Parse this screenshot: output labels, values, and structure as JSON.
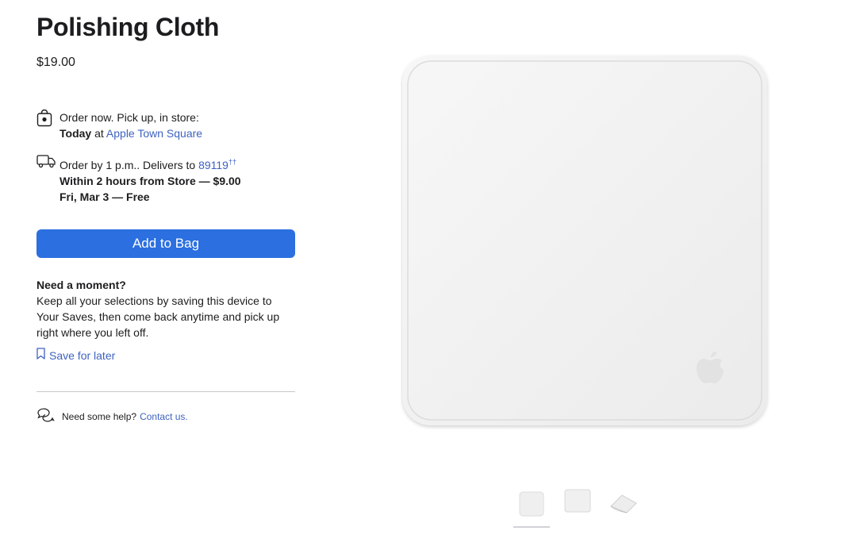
{
  "product": {
    "title": "Polishing Cloth",
    "price": "$19.00",
    "image_alt": "White polishing cloth with Apple logo"
  },
  "pickup": {
    "icon": "store-bag-icon",
    "line1": "Order now. Pick up, in store:",
    "day": "Today",
    "at": "at",
    "store": "Apple Town Square"
  },
  "delivery": {
    "icon": "delivery-truck-icon",
    "line1_prefix": "Order by 1 p.m.. Delivers to",
    "zip": "89119",
    "zip_suffix": "††",
    "option1": "Within 2 hours from Store — $9.00",
    "option2": "Fri, Mar 3 — Free"
  },
  "add_to_bag_label": "Add to Bag",
  "save": {
    "heading": "Need a moment?",
    "body": "Keep all your selections by saving this device to Your Saves, then come back anytime and pick up right where you left off.",
    "link": "Save for later",
    "icon": "bookmark-icon"
  },
  "help": {
    "icon": "chat-bubbles-icon",
    "text": "Need some help?",
    "link": "Contact us."
  },
  "gallery": {
    "thumbnails": [
      "cloth-front-thumb",
      "cloth-flat-thumb",
      "cloth-folded-thumb"
    ],
    "selected_index": 0
  },
  "colors": {
    "link": "#3e62c0",
    "button": "#2b6fe0",
    "text": "#1d1d1f"
  }
}
